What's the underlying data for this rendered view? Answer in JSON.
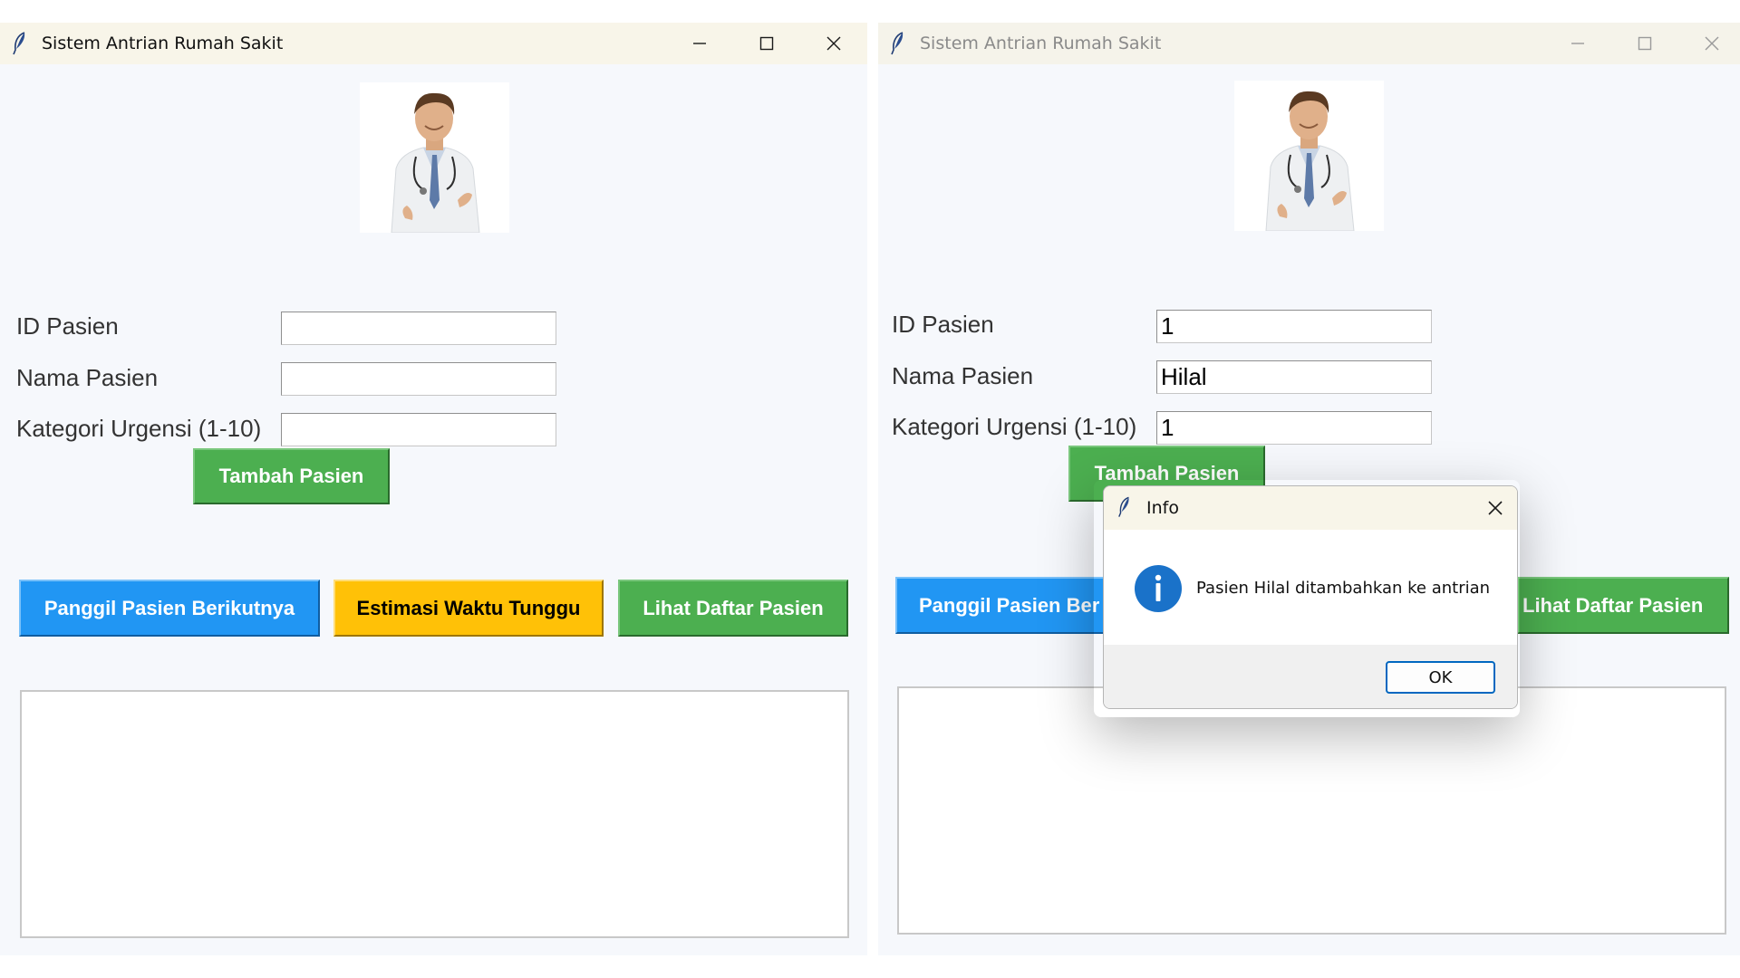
{
  "colors": {
    "background": "#f6f8fc",
    "green_button": "#4caf50",
    "blue_button": "#2196f3",
    "yellow_button": "#ffc107",
    "dialog_accent": "#0067c0"
  },
  "left_window": {
    "title": "Sistem Antrian Rumah Sakit",
    "icons": [
      "feather-icon",
      "minimize-icon",
      "maximize-icon",
      "close-icon"
    ],
    "image": "doctor-photo",
    "form": {
      "id_label": "ID Pasien",
      "id_value": "",
      "name_label": "Nama Pasien",
      "name_value": "",
      "urgency_label": "Kategori Urgensi (1-10)",
      "urgency_value": ""
    },
    "buttons": {
      "add": "Tambah Pasien",
      "call_next": "Panggil Pasien Berikutnya",
      "estimate": "Estimasi Waktu Tunggu",
      "view_list": "Lihat Daftar Pasien"
    }
  },
  "right_window": {
    "title": "Sistem Antrian Rumah Sakit",
    "icons": [
      "feather-icon",
      "minimize-icon",
      "maximize-icon",
      "close-icon"
    ],
    "image": "doctor-photo",
    "form": {
      "id_label": "ID Pasien",
      "id_value": "1",
      "name_label": "Nama Pasien",
      "name_value": "Hilal",
      "urgency_label": "Kategori Urgensi (1-10)",
      "urgency_value": "1"
    },
    "buttons": {
      "add": "Tambah Pasien",
      "call_next_visible": "Panggil Pasien Ber",
      "view_list_visible": "Lihat Daftar Pasien"
    }
  },
  "dialog": {
    "title": "Info",
    "icon": "info-icon",
    "message": "Pasien Hilal ditambahkan ke antrian",
    "ok_label": "OK"
  }
}
